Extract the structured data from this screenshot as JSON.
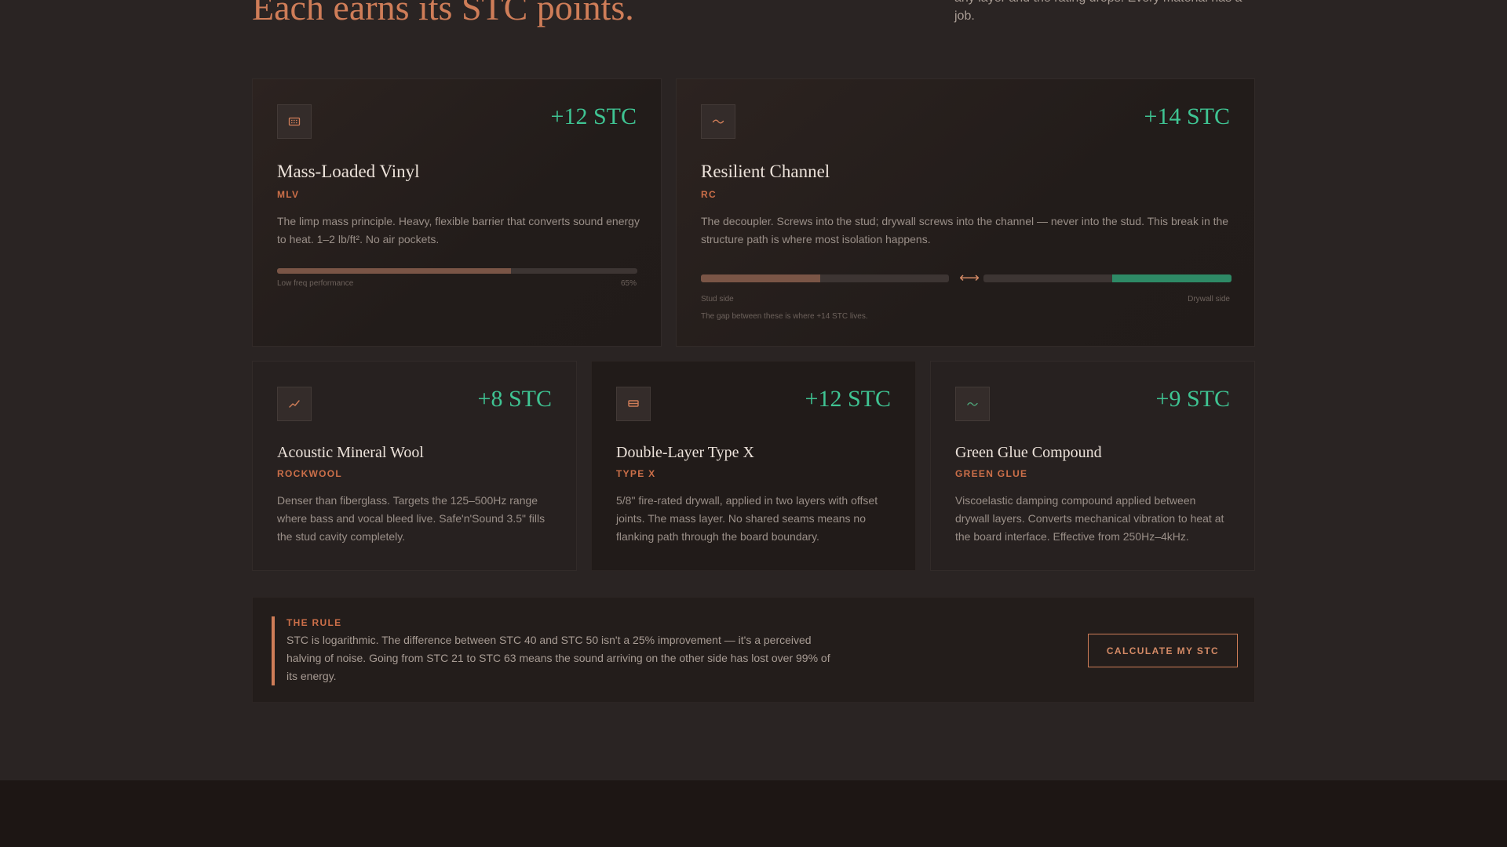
{
  "headline": "Each earns its STC points.",
  "lede": "any layer and the rating drops. Every material has a job.",
  "colors": {
    "accent": "#cf7d58",
    "stc_green": "#3fc493",
    "bar_brown": "#7a5546",
    "bar_green": "#2e8a66"
  },
  "cards": [
    {
      "icon": "vinyl-sheet-icon",
      "stc": "+12 STC",
      "title": "Mass-Loaded Vinyl",
      "tag": "MLV",
      "description": "The limp mass principle. Heavy, flexible barrier that converts sound energy to heat. 1–2 lb/ft². No air pockets.",
      "meter": {
        "label": "Low freq performance",
        "value_label": "65%",
        "value": 0.65
      }
    },
    {
      "icon": "wave-channel-icon",
      "stc": "+14 STC",
      "title": "Resilient Channel",
      "tag": "RC",
      "description": "The decoupler. Screws into the stud; drywall screws into the channel — never into the stud. This break in the structure path is where most isolation happens.",
      "decouple": {
        "left_label": "Stud side",
        "right_label": "Drywall side",
        "left_fill": 0.48,
        "right_fill": 0.48,
        "note": "The gap between these is where +14 STC lives."
      }
    },
    {
      "icon": "mineral-wool-icon",
      "stc": "+8 STC",
      "title": "Acoustic Mineral Wool",
      "tag": "ROCKWOOL",
      "description": "Denser than fiberglass. Targets the 125–500Hz range where bass and vocal bleed live. Safe'n'Sound 3.5\" fills the stud cavity completely."
    },
    {
      "icon": "drywall-layers-icon",
      "stc": "+12 STC",
      "title": "Double-Layer Type X",
      "tag": "TYPE X",
      "description": "5/8\" fire-rated drywall, applied in two layers with offset joints. The mass layer. No shared seams means no flanking path through the board boundary."
    },
    {
      "icon": "damping-glue-icon",
      "stc": "+9 STC",
      "title": "Green Glue Compound",
      "tag": "GREEN GLUE",
      "description": "Viscoelastic damping compound applied between drywall layers. Converts mechanical vibration to heat at the board interface. Effective from 250Hz–4kHz."
    }
  ],
  "rule": {
    "label": "THE RULE",
    "text": "STC is logarithmic. The difference between STC 40 and STC 50 isn't a 25% improvement — it's a perceived halving of noise. Going from STC 21 to STC 63 means the sound arriving on the other side has lost over 99% of its energy.",
    "cta": "CALCULATE MY STC"
  }
}
